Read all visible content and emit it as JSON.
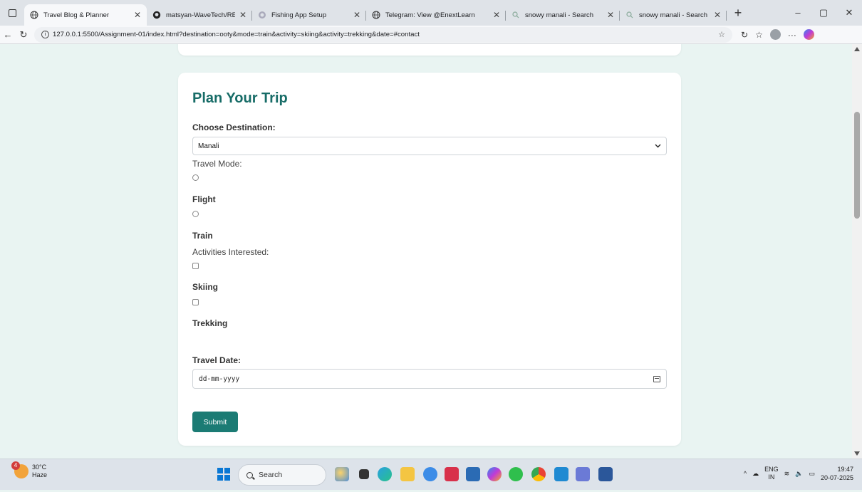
{
  "browser": {
    "tabs": [
      {
        "title": "Travel Blog & Planner",
        "active": true,
        "icon": "globe-icon"
      },
      {
        "title": "matsyan-WaveTech/READM",
        "active": false,
        "icon": "github-icon"
      },
      {
        "title": "Fishing App Setup",
        "active": false,
        "icon": "chat-icon"
      },
      {
        "title": "Telegram: View @EnextLearn",
        "active": false,
        "icon": "globe-icon"
      },
      {
        "title": "snowy manali - Search",
        "active": false,
        "icon": "search-icon"
      },
      {
        "title": "snowy manali - Search Imag",
        "active": false,
        "icon": "search-icon"
      }
    ],
    "new_tab": "+",
    "url": "127.0.0.1:5500/Assignment-01/index.html?destination=ooty&mode=train&activity=skiing&activity=trekking&date=#contact",
    "window_controls": {
      "minimize": "–",
      "maximize": "▢",
      "close": "✕"
    }
  },
  "form": {
    "title": "Plan Your Trip",
    "destination_label": "Choose Destination:",
    "destination_value": "Manali",
    "travel_mode_label": "Travel Mode:",
    "mode_options": [
      {
        "label": "Flight",
        "checked": false
      },
      {
        "label": "Train",
        "checked": false
      }
    ],
    "activities_label": "Activities Interested:",
    "activity_options": [
      {
        "label": "Skiing",
        "checked": false
      },
      {
        "label": "Trekking",
        "checked": false
      }
    ],
    "date_label": "Travel Date:",
    "date_placeholder": "dd-mm-yyyy",
    "submit_label": "Submit"
  },
  "taskbar": {
    "weather": {
      "badge": "4",
      "temp": "30°C",
      "condition": "Haze"
    },
    "search_label": "Search",
    "tray": {
      "lang_top": "ENG",
      "lang_bottom": "IN",
      "time": "19:47",
      "date": "20-07-2025"
    }
  },
  "colors": {
    "accent": "#1b7b74",
    "title": "#176c67",
    "page_bg": "#e9f4f2"
  }
}
